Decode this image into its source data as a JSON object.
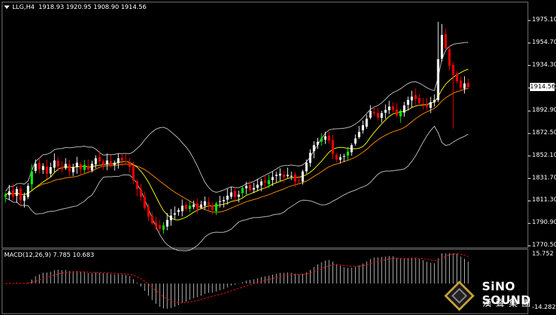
{
  "header": {
    "symbol_tf": "LLG,H4",
    "ohlc": "1918.93 1920.95 1908.90 1914.56"
  },
  "price_axis": {
    "labels": [
      "1975.10",
      "1954.70",
      "1934.30",
      "1913.90",
      "1892.90",
      "1872.50",
      "1852.10",
      "1831.70",
      "1811.30",
      "1790.90",
      "1770.50"
    ],
    "current_price": "1914.56"
  },
  "macd": {
    "title": "MACD(12,26,9) 7.785 10.683",
    "top_label": "15.752",
    "bottom_label": "-14.282"
  },
  "logo": {
    "name": "SiNO SOUND",
    "cn": "漢聲集團"
  },
  "colors": {
    "background": "#000000",
    "bull_candle": "#ffffff",
    "bear_candle": "#ff0000",
    "bull_body_alt": "#00ff00",
    "ma_line": "#ffff00",
    "bands": "#c0c0c0",
    "macd_hist": "#c0c0c0",
    "macd_signal": "#ff0000",
    "grid": "#808080"
  },
  "chart_data": {
    "type": "candlestick",
    "price_range": [
      1770.5,
      1975.1
    ],
    "closes": [
      1817,
      1820,
      1815,
      1822,
      1812,
      1816,
      1825,
      1838,
      1845,
      1840,
      1843,
      1836,
      1842,
      1848,
      1843,
      1840,
      1845,
      1838,
      1842,
      1846,
      1840,
      1844,
      1840,
      1845,
      1850,
      1847,
      1844,
      1848,
      1844,
      1846,
      1850,
      1848,
      1847,
      1842,
      1830,
      1822,
      1815,
      1805,
      1797,
      1791,
      1788,
      1786,
      1789,
      1794,
      1798,
      1800,
      1803,
      1807,
      1804,
      1807,
      1808,
      1804,
      1808,
      1811,
      1808,
      1803,
      1809,
      1811,
      1812,
      1816,
      1819,
      1815,
      1817,
      1823,
      1825,
      1821,
      1823,
      1826,
      1829,
      1828,
      1830,
      1833,
      1835,
      1836,
      1833,
      1835,
      1834,
      1829,
      1830,
      1838,
      1846,
      1855,
      1862,
      1865,
      1868,
      1870,
      1866,
      1854,
      1849,
      1851,
      1852,
      1856,
      1862,
      1868,
      1874,
      1880,
      1886,
      1893,
      1891,
      1887,
      1891,
      1894,
      1897,
      1894,
      1889,
      1893,
      1898,
      1903,
      1906,
      1904,
      1900,
      1899,
      1897,
      1901,
      1903,
      1940,
      1962,
      1950,
      1934,
      1926,
      1920,
      1914,
      1918,
      1914.56
    ],
    "bb_period": 20,
    "ma_period": 9,
    "macd": {
      "fast": 12,
      "slow": 26,
      "signal": 9,
      "value": 7.785,
      "signal_value": 10.683,
      "range": [
        -14.282,
        15.752
      ]
    }
  }
}
